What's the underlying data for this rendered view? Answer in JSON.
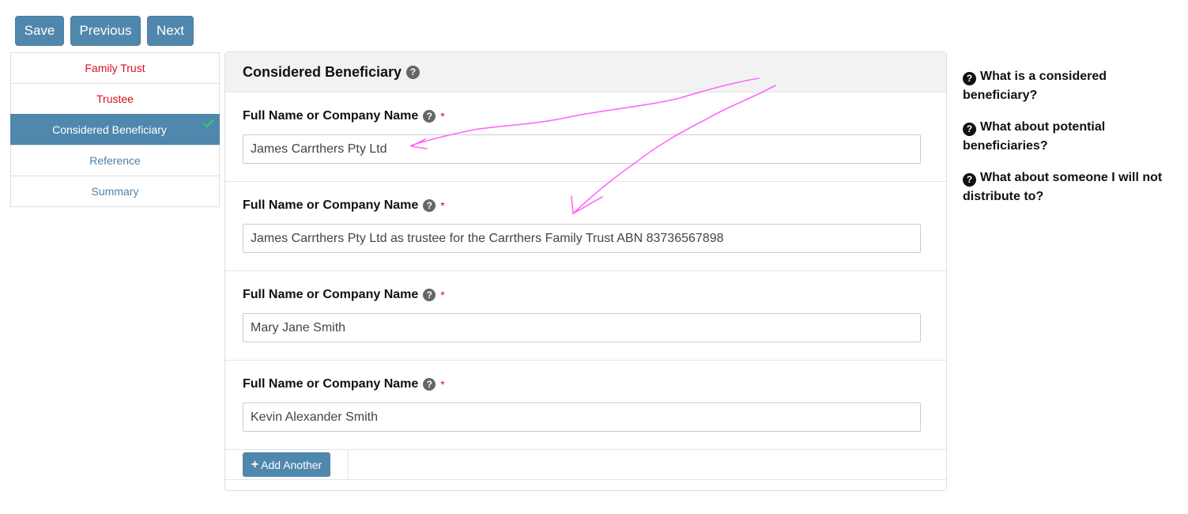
{
  "toolbar": {
    "save_label": "Save",
    "previous_label": "Previous",
    "next_label": "Next"
  },
  "sidenav": {
    "items": [
      {
        "label": "Family Trust",
        "state": "error"
      },
      {
        "label": "Trustee",
        "state": "error"
      },
      {
        "label": "Considered Beneficiary",
        "state": "active"
      },
      {
        "label": "Reference",
        "state": "link"
      },
      {
        "label": "Summary",
        "state": "link"
      }
    ]
  },
  "panel": {
    "title": "Considered Beneficiary",
    "help_icon": "?",
    "fields": [
      {
        "label": "Full Name or Company Name",
        "required_mark": "*",
        "value": "James Carrthers Pty Ltd"
      },
      {
        "label": "Full Name or Company Name",
        "required_mark": "*",
        "value": "James Carrthers Pty Ltd as trustee for the Carrthers Family Trust ABN 83736567898"
      },
      {
        "label": "Full Name or Company Name",
        "required_mark": "*",
        "value": "Mary Jane Smith"
      },
      {
        "label": "Full Name or Company Name",
        "required_mark": "*",
        "value": "Kevin Alexander Smith"
      }
    ],
    "add_label": "Add Another",
    "add_icon": "+"
  },
  "help": {
    "icon": "?",
    "items": [
      "What is a considered beneficiary?",
      "What about potential beneficiaries?",
      "What about someone I will not distribute to?"
    ]
  },
  "colors": {
    "primary": "#5087ad",
    "error": "#d9101c",
    "link": "#4e7fa6",
    "check": "#2ecc71",
    "annotation": "#ff66ff"
  }
}
